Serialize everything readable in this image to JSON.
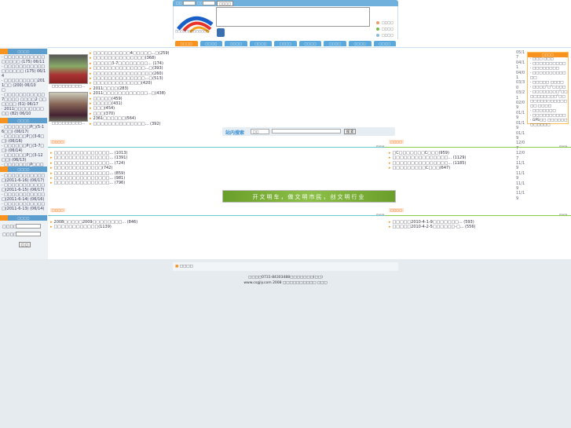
{
  "header": {
    "login_user_label": "□□",
    "login_pass_label": "□□",
    "login_button": "□□□□",
    "links": [
      "□□□□",
      "□□□□",
      "□□□□"
    ],
    "logo_text": "□□□□□□□□□□□□□"
  },
  "nav": [
    "□□□□",
    "□□□□",
    "□□□□",
    "□□□□",
    "□□□□",
    "□□□□",
    "□□□□",
    "□□□□",
    "□□□□"
  ],
  "sidebar": {
    "box1": {
      "title": "□□□□",
      "items": [
        "· □□□□□□□□□□□□□□□□ (175) 06/11",
        "· □□□□□□□□□□□□□□□□□ (175) 06/14",
        "· □□□□□□□□□2011□□ (200) 06/10",
        "□",
        "· □□□□□□□□□□□7□□□□ □□□□2 □□□□□□ (51) 06/17",
        "· 2011□□□□□□□□□□ (82) 06/10"
      ]
    },
    "box2": {
      "title": "□□□□",
      "items": [
        "· □□□□□□□P□(5-16□□) (06/17)",
        "· □□□□□□P□(3-6□□) (06/16)",
        "· □□□□□□P□(3-7□□) (06/14)",
        "· □□□□□□P□(3-12□□) (06/13)",
        "· □□□□□□□P□□□ (06/10)"
      ]
    },
    "box3": {
      "title": "□□□□",
      "items": [
        "· □□□□□□□□□□□□(2011-6-16) (06/17)",
        "· □□□□□□□□□□□□(2011-6-15) (06/17)",
        "· □□□□□□□□□□□□(2011-6-14) (06/16)",
        "· □□□□□□□□□□□□(2011-6-13) (06/14)"
      ]
    },
    "login": {
      "title": "□□□□",
      "user_label": "□□□□",
      "pass_label": "□□□□",
      "button": "□ □"
    }
  },
  "photos": [
    {
      "caption": "□□□□□□□□□..."
    },
    {
      "caption": "□□□□□□□□□..."
    }
  ],
  "top_news": [
    "□□□□□□□□□□4□□□□□...□(259)",
    "□□□□□□□□□□□□□□(368)",
    "□□□□□3-7□□□□□□□□... (174)",
    "□□□□□□□□□□□□□□...□(393)",
    "□□□□□□□□□□□□□□□□(260)",
    "□□□□□□□□□□□□□□...□(513)",
    "□□□□□□□□□□□□□(420)",
    "2011□□□□(283)",
    "2011□□□□□□□□□□□□...□(438)",
    "□□□□□(459)",
    "□□□□□(431)",
    "□□□(454)",
    "□□□(370)",
    "2361□□□□□□(564)",
    "□□□□□□□□□□□□□□... (392)"
  ],
  "dates": [
    "05/17",
    "04/11",
    "04/01",
    "03/30",
    "03/21",
    "02/09",
    "01/19",
    "01/19",
    "01/19",
    "12/07",
    "12/07",
    "11/19",
    "11/19",
    "11/19",
    "11/19"
  ],
  "notice_box": {
    "title": "□□□□",
    "items": [
      "· □□□ □□□",
      "· □□□□□□□□□□",
      "· □□□□□□□□",
      "· □□□□□□□□□□□□",
      "· □□□□□ □□□□",
      "· □□□□\"□\"□□□□",
      "· □□□□□□□□\"□□□□□□□□□□\"□□□□□□□□□□□□□□□ □□□□",
      "· □□□□□□□",
      "· □□□□□□□□□□",
      "· GPS□□ □□□□□□□□□□□□"
    ]
  },
  "search": {
    "title": "站内搜索",
    "select": "□□",
    "button": "搜 索"
  },
  "section1": {
    "left_tag": "□□□□",
    "right_tag": "□□□□",
    "more": "more",
    "left_items": [
      "□□□□□□□□□□□□□□□... (1013)",
      "□□□□□□□□□□□□□□□... (1391)",
      "□□□□□□□□□□□□□□□... (724)",
      "□□□□□□□□□□□□□(742)",
      "□□□□□□□□□□□□□□□... (859)",
      "□□□□□□□□□□□□□□□... (981)",
      "□□□□□□□□□□□□□□□... (796)"
    ],
    "right_items": [
      "□C□□□□□□□C□□□(959)",
      "□□□□□□□□□□□□□□□... (1129)",
      "□□□□□□□□□□□□□□□... (1185)",
      "□□□□□□□□□C□□□(647)"
    ]
  },
  "slogan": "开文明车，做文明市民，创文明行业",
  "section2": {
    "left_tag": "□□□□",
    "right_tag": "□□□□",
    "more": "more",
    "left_items": [
      "2008□□□□□2009□□□□□□□□... (846)",
      "□□□□□□□□□□□□(1139)"
    ],
    "right_items": [
      "□□□□□2010-4-1-9□□□□□□□... (593)",
      "□□□□□2010-4-2-5□□□□□□-□... (556)"
    ]
  },
  "footer": {
    "bar_label": "□□□□",
    "line1": "□□□□0731-84303488□□□□□□□(□□)",
    "line2": "www.csgjly.com 2008 □□□□□□□□□□ □□□"
  },
  "colors": {
    "accent_blue": "#5c9ece",
    "accent_orange": "#f7931e",
    "accent_green": "#8cc048"
  }
}
